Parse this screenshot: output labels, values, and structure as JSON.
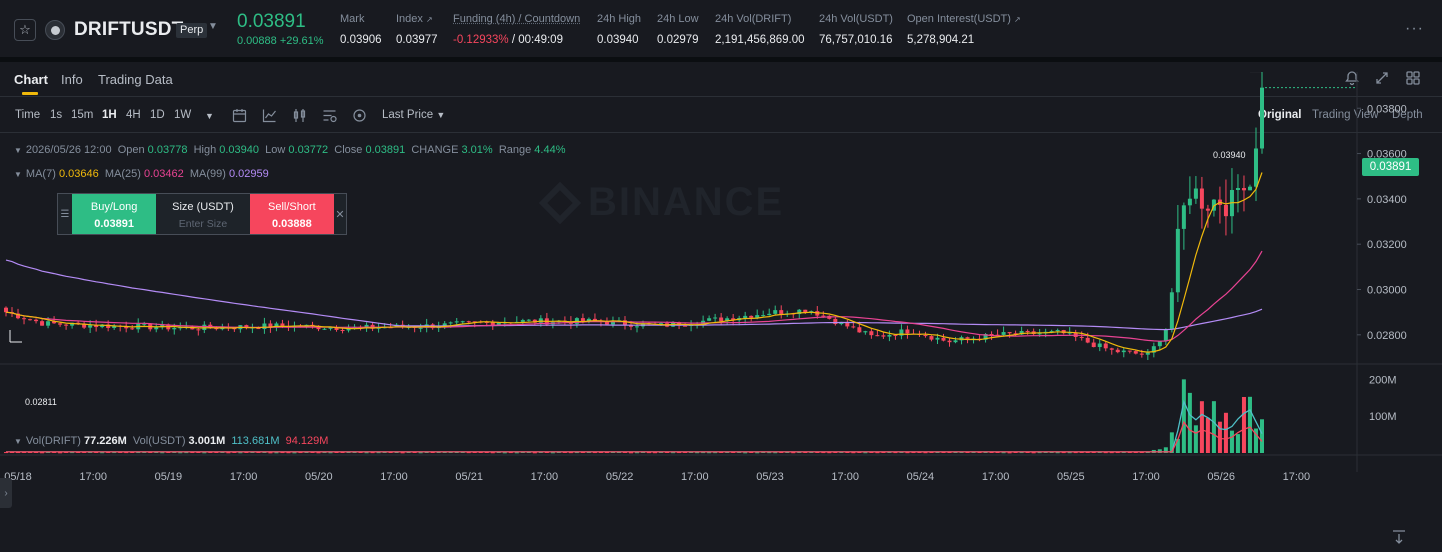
{
  "header": {
    "symbol": "DRIFTUSDT",
    "badge": "Perp",
    "last_price": "0.03891",
    "change_abs": "0.00888",
    "change_pct": "+29.61%",
    "stats": [
      {
        "label": "Mark",
        "value": "0.03906"
      },
      {
        "label": "Index",
        "value": "0.03977"
      },
      {
        "label": "Funding (4h) / Countdown",
        "value_neg": "-0.12933%",
        "value": " / 00:49:09"
      },
      {
        "label": "24h High",
        "value": "0.03940"
      },
      {
        "label": "24h Low",
        "value": "0.02979"
      },
      {
        "label": "24h Vol(DRIFT)",
        "value": "2,191,456,869.00"
      },
      {
        "label": "24h Vol(USDT)",
        "value": "76,757,010.16"
      },
      {
        "label": "Open Interest(USDT)",
        "value": "5,278,904.21"
      }
    ]
  },
  "tabs": {
    "chart": "Chart",
    "info": "Info",
    "trading_data": "Trading Data"
  },
  "toolbar": {
    "intervals": [
      "Time",
      "1s",
      "15m",
      "1H",
      "4H",
      "1D",
      "1W"
    ],
    "active_interval": "1H",
    "price_type": "Last Price",
    "views": [
      "Original",
      "Trading View",
      "Depth"
    ],
    "active_view": "Original"
  },
  "legend": {
    "date": "2026/05/26 12:00",
    "open_label": "Open",
    "open": "0.03778",
    "high_label": "High",
    "high": "0.03940",
    "low_label": "Low",
    "low": "0.03772",
    "close_label": "Close",
    "close": "0.03891",
    "change_label": "CHANGE",
    "change": "3.01%",
    "range_label": "Range",
    "range": "4.44%",
    "ma7_label": "MA(7)",
    "ma7": "0.03646",
    "ma25_label": "MA(25)",
    "ma25": "0.03462",
    "ma99_label": "MA(99)",
    "ma99": "0.02959"
  },
  "volume_legend": {
    "vol_drift_label": "Vol(DRIFT)",
    "vol_drift": "77.226M",
    "vol_usdt_label": "Vol(USDT)",
    "vol_usdt": "3.001M",
    "ma1": "113.681M",
    "ma2": "94.129M"
  },
  "order_widget": {
    "buy_label": "Buy/Long",
    "buy_price": "0.03891",
    "size_label": "Size (USDT)",
    "size_placeholder": "Enter Size",
    "sell_label": "Sell/Short",
    "sell_price": "0.03888"
  },
  "price_badge": "0.03891",
  "high_marker": "0.03940",
  "low_marker": "0.02811",
  "watermark": "BINANCE",
  "colors": {
    "up": "#2ebd85",
    "down": "#f6465d",
    "ma7": "#f0b90b",
    "ma25": "#e84393",
    "ma99": "#b38bf5",
    "accent": "#f0b90b"
  },
  "chart_data": {
    "type": "candlestick",
    "y_axis_ticks": [
      "0.03800",
      "0.03600",
      "0.03400",
      "0.03200",
      "0.03000",
      "0.02800"
    ],
    "ylim": [
      0.0268,
      0.0396
    ],
    "x_axis_ticks": [
      "05/18",
      "17:00",
      "05/19",
      "17:00",
      "05/20",
      "17:00",
      "05/21",
      "17:00",
      "05/22",
      "17:00",
      "05/23",
      "17:00",
      "05/24",
      "17:00",
      "05/25",
      "17:00",
      "05/26",
      "17:00"
    ],
    "volume_axis_ticks": [
      "200M",
      "100M"
    ],
    "volume_ylim": [
      0,
      220
    ],
    "close_series_anchors": [
      [
        0,
        0.029
      ],
      [
        0.03,
        0.0285
      ],
      [
        0.08,
        0.0284
      ],
      [
        0.15,
        0.0283
      ],
      [
        0.22,
        0.0284
      ],
      [
        0.28,
        0.0283
      ],
      [
        0.34,
        0.0284
      ],
      [
        0.4,
        0.0286
      ],
      [
        0.47,
        0.0286
      ],
      [
        0.52,
        0.0284
      ],
      [
        0.57,
        0.0287
      ],
      [
        0.61,
        0.029
      ],
      [
        0.64,
        0.0291
      ],
      [
        0.69,
        0.0279
      ],
      [
        0.72,
        0.0282
      ],
      [
        0.75,
        0.0277
      ],
      [
        0.79,
        0.028
      ],
      [
        0.84,
        0.0281
      ],
      [
        0.88,
        0.0273
      ],
      [
        0.91,
        0.0271
      ],
      [
        0.925,
        0.0284
      ],
      [
        0.935,
        0.033
      ],
      [
        0.943,
        0.0345
      ],
      [
        0.955,
        0.0338
      ],
      [
        0.965,
        0.034
      ],
      [
        0.975,
        0.0337
      ],
      [
        0.985,
        0.035
      ],
      [
        0.99,
        0.0345
      ],
      [
        0.995,
        0.0365
      ],
      [
        1.0,
        0.03891
      ]
    ],
    "volume_anchors": [
      [
        0,
        3
      ],
      [
        0.9,
        3
      ],
      [
        0.915,
        8
      ],
      [
        0.925,
        25
      ],
      [
        0.932,
        60
      ],
      [
        0.938,
        190
      ],
      [
        0.945,
        110
      ],
      [
        0.952,
        140
      ],
      [
        0.96,
        120
      ],
      [
        0.968,
        80
      ],
      [
        0.975,
        90
      ],
      [
        0.982,
        130
      ],
      [
        0.99,
        160
      ],
      [
        1.0,
        70
      ]
    ]
  }
}
